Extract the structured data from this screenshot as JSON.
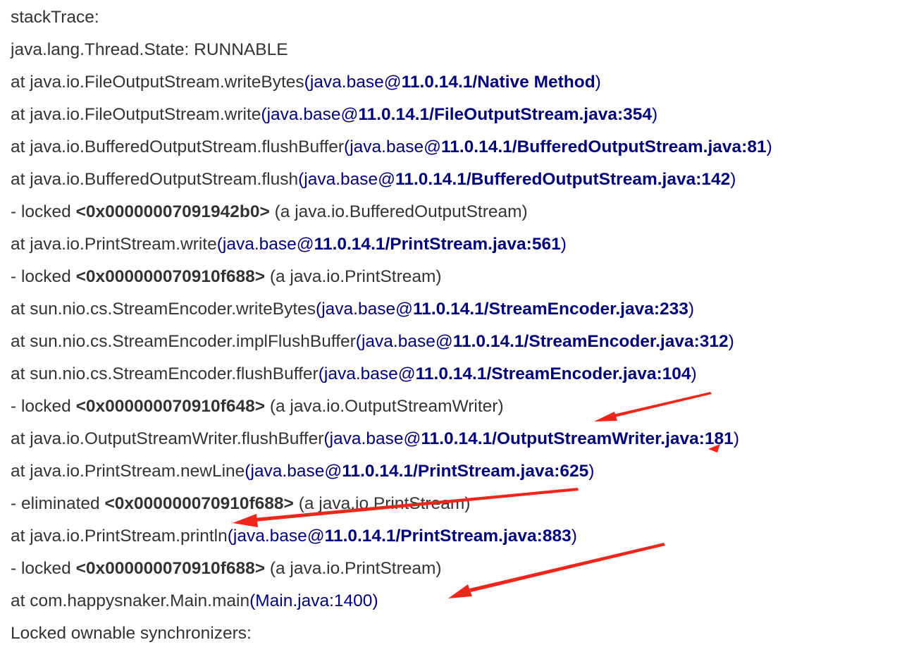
{
  "header": "stackTrace:",
  "state": "java.lang.Thread.State: RUNNABLE",
  "lines": [
    {
      "kind": "frame",
      "method": "at java.io.FileOutputStream.writeBytes",
      "module": "java.base@",
      "location": "11.0.14.1/Native Method"
    },
    {
      "kind": "frame",
      "method": "at java.io.FileOutputStream.write",
      "module": "java.base@",
      "location": "11.0.14.1/FileOutputStream.java:354"
    },
    {
      "kind": "frame",
      "method": "at java.io.BufferedOutputStream.flushBuffer",
      "module": "java.base@",
      "location": "11.0.14.1/BufferedOutputStream.java:81"
    },
    {
      "kind": "frame",
      "method": "at java.io.BufferedOutputStream.flush",
      "module": "java.base@",
      "location": "11.0.14.1/BufferedOutputStream.java:142"
    },
    {
      "kind": "lock",
      "action": "- locked",
      "address": "<0x00000007091942b0>",
      "target": "(a java.io.BufferedOutputStream)"
    },
    {
      "kind": "frame",
      "method": "at java.io.PrintStream.write",
      "module": "java.base@",
      "location": "11.0.14.1/PrintStream.java:561"
    },
    {
      "kind": "lock",
      "action": "- locked",
      "address": "<0x000000070910f688>",
      "target": "(a java.io.PrintStream)"
    },
    {
      "kind": "frame",
      "method": "at sun.nio.cs.StreamEncoder.writeBytes",
      "module": "java.base@",
      "location": "11.0.14.1/StreamEncoder.java:233"
    },
    {
      "kind": "frame",
      "method": "at sun.nio.cs.StreamEncoder.implFlushBuffer",
      "module": "java.base@",
      "location": "11.0.14.1/StreamEncoder.java:312"
    },
    {
      "kind": "frame",
      "method": "at sun.nio.cs.StreamEncoder.flushBuffer",
      "module": "java.base@",
      "location": "11.0.14.1/StreamEncoder.java:104"
    },
    {
      "kind": "lock",
      "action": "- locked",
      "address": "<0x000000070910f648>",
      "target": "(a java.io.OutputStreamWriter)"
    },
    {
      "kind": "frame",
      "method": "at java.io.OutputStreamWriter.flushBuffer",
      "module": "java.base@",
      "location": "11.0.14.1/OutputStreamWriter.java:181"
    },
    {
      "kind": "frame",
      "method": "at java.io.PrintStream.newLine",
      "module": "java.base@",
      "location": "11.0.14.1/PrintStream.java:625"
    },
    {
      "kind": "lock",
      "action": "- eliminated",
      "address": "<0x000000070910f688>",
      "target": "(a java.io.PrintStream)"
    },
    {
      "kind": "frame",
      "method": "at java.io.PrintStream.println",
      "module": "java.base@",
      "location": "11.0.14.1/PrintStream.java:883"
    },
    {
      "kind": "lock",
      "action": "- locked",
      "address": "<0x000000070910f688>",
      "target": "(a java.io.PrintStream)"
    },
    {
      "kind": "frame-plain",
      "method": "at com.happysnaker.Main.main",
      "location": "Main.java:1400"
    }
  ],
  "footer": "Locked ownable synchronizers:",
  "colors": {
    "text": "#333333",
    "link": "#00007a",
    "arrow": "#f0261b"
  }
}
